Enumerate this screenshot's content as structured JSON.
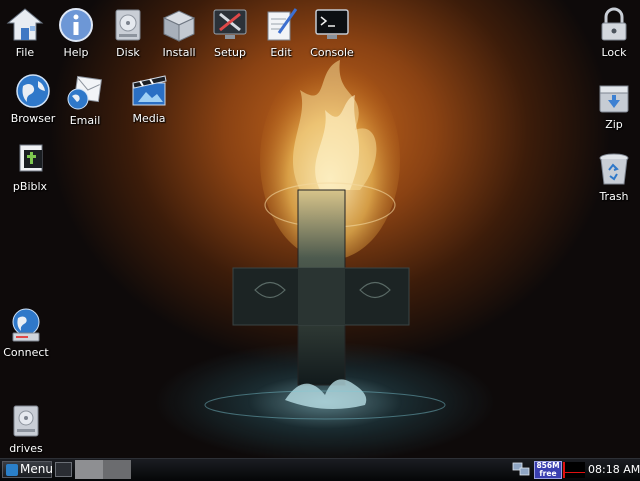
{
  "desktop": {
    "icons": [
      {
        "label": "File",
        "icon": "home-folder-icon"
      },
      {
        "label": "Help",
        "icon": "info-icon"
      },
      {
        "label": "Disk",
        "icon": "hard-disk-icon"
      },
      {
        "label": "Install",
        "icon": "package-box-icon"
      },
      {
        "label": "Setup",
        "icon": "setup-tools-icon"
      },
      {
        "label": "Edit",
        "icon": "text-editor-icon"
      },
      {
        "label": "Console",
        "icon": "terminal-icon"
      },
      {
        "label": "Lock",
        "icon": "padlock-icon"
      },
      {
        "label": "Browser",
        "icon": "globe-icon"
      },
      {
        "label": "Email",
        "icon": "mail-icon"
      },
      {
        "label": "Media",
        "icon": "film-clapper-icon"
      },
      {
        "label": "Zip",
        "icon": "archive-box-icon"
      },
      {
        "label": "pBiblx",
        "icon": "bible-app-icon"
      },
      {
        "label": "Trash",
        "icon": "trash-can-icon"
      },
      {
        "label": "Connect",
        "icon": "network-globe-icon"
      },
      {
        "label": "drives",
        "icon": "drive-icon"
      }
    ]
  },
  "taskbar": {
    "menu_label": "Menu",
    "memory_line1": "856M",
    "memory_line2": "free",
    "clock": "08:18 AM"
  },
  "colors": {
    "wallpaper_glow": "#c4661d",
    "wallpaper_dark": "#07090d",
    "taskbar_bg": "#050607",
    "memory_badge": "#3a3fb0",
    "cpu_graph_line": "#e01010"
  }
}
